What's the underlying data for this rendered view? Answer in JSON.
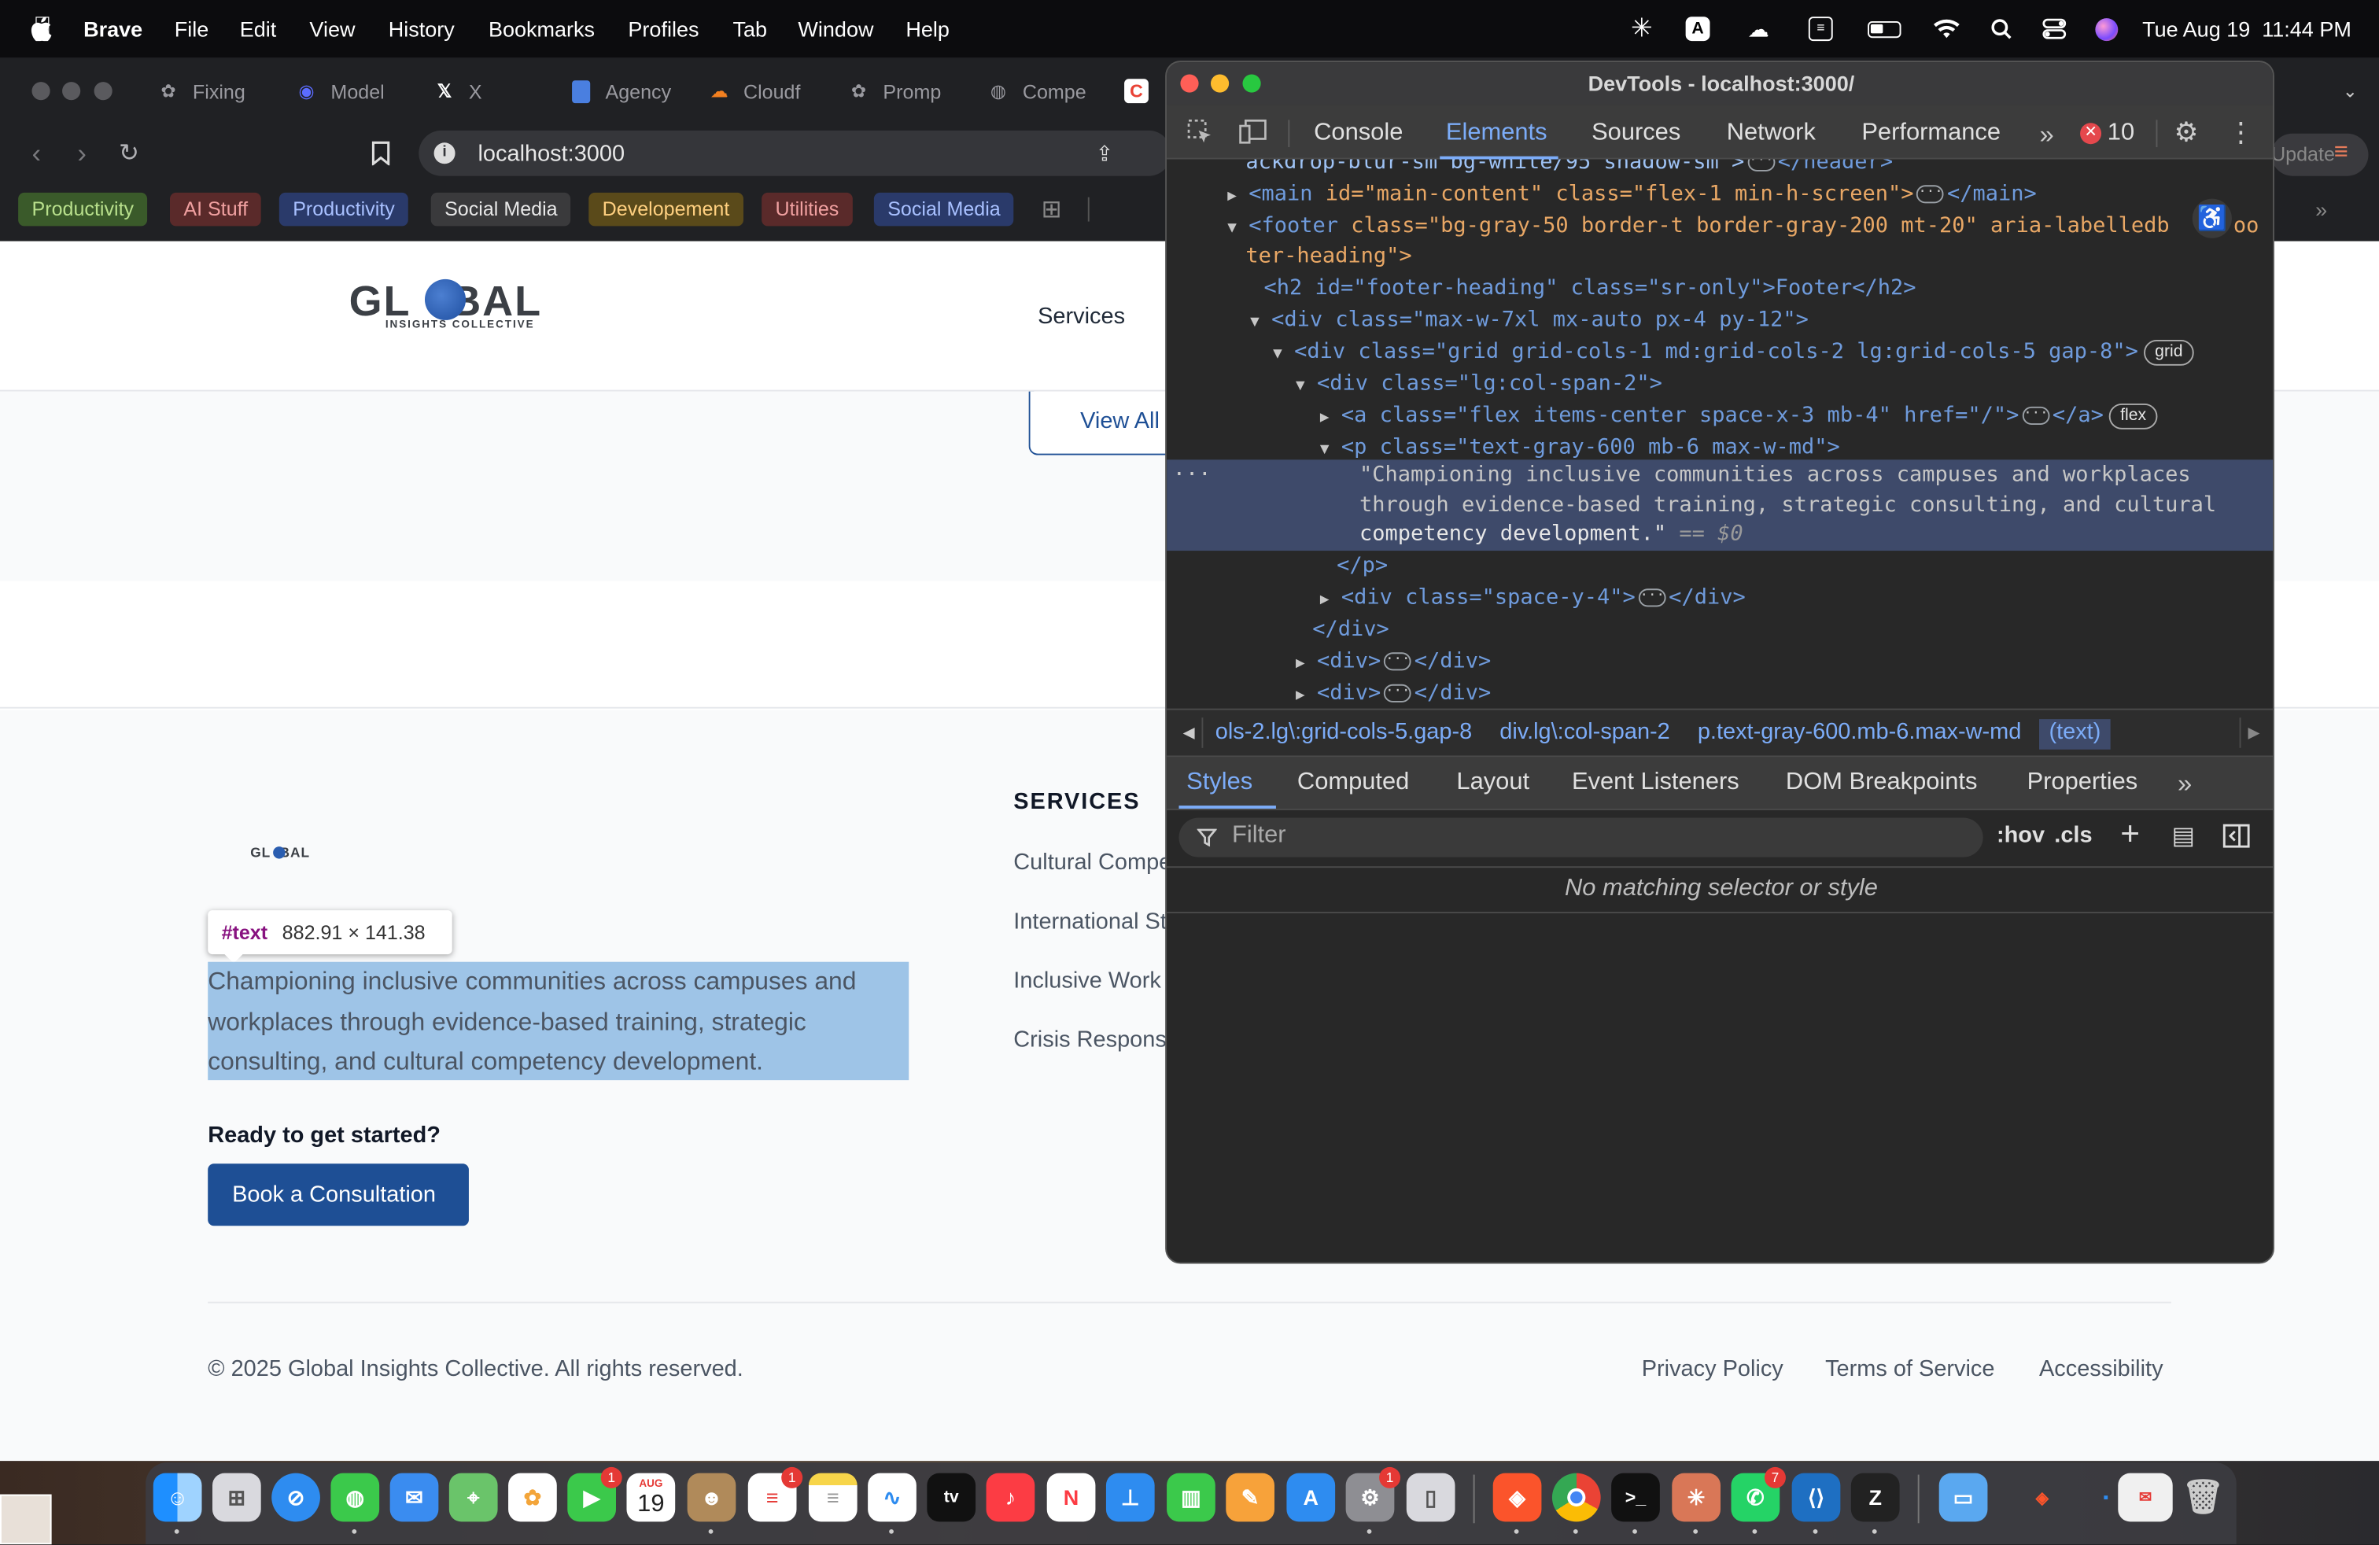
{
  "menubar": {
    "app": "Brave",
    "items": [
      "File",
      "Edit",
      "View",
      "History",
      "Bookmarks",
      "Profiles",
      "Tab",
      "Window",
      "Help"
    ],
    "datetime": "Tue Aug 19  11:44 PM"
  },
  "tabs": [
    "Fixing",
    "Model",
    "X",
    "Agency",
    "Cloudf",
    "Promp",
    "Compe"
  ],
  "address": {
    "url": "localhost:3000",
    "update_label": "Update"
  },
  "bookmarks": [
    {
      "label": "Productivity",
      "bg": "#3a5a2a",
      "fg": "#b8e08c"
    },
    {
      "label": "AI Stuff",
      "bg": "#5a2a2a",
      "fg": "#f0a0a0"
    },
    {
      "label": "Productivity",
      "bg": "#2a3a6a",
      "fg": "#a8c0ff"
    },
    {
      "label": "Social Media",
      "bg": "#3a3a3c",
      "fg": "#e8e8e8"
    },
    {
      "label": "Developement",
      "bg": "#5a4a1a",
      "fg": "#ffd080"
    },
    {
      "label": "Utilities",
      "bg": "#5a2a2a",
      "fg": "#f0a0a0"
    },
    {
      "label": "Social Media",
      "bg": "#2a3a6a",
      "fg": "#a8c0ff"
    }
  ],
  "site": {
    "logo_text": "GL   BAL",
    "logo_sub": "INSIGHTS COLLECTIVE",
    "nav_services": "Services",
    "view_all": "View All",
    "footer": {
      "logo_small": "GL  BAL",
      "tooltip_node": "#text",
      "tooltip_size": "882.91 × 141.38",
      "tagline": "Championing inclusive communities across campuses and workplaces through evidence-based training, strategic consulting, and cultural competency development.",
      "cta_heading": "Ready to get started?",
      "cta_button": "Book a Consultation",
      "services_heading": "SERVICES",
      "services": [
        "Cultural Compe",
        "International St",
        "Inclusive Work",
        "Crisis Respons"
      ],
      "copyright": "© 2025 Global Insights Collective. All rights reserved.",
      "links": [
        "Privacy Policy",
        "Terms of Service",
        "Accessibility"
      ]
    }
  },
  "devtools": {
    "title": "DevTools - localhost:3000/",
    "tabs": [
      "Console",
      "Elements",
      "Sources",
      "Network",
      "Performance"
    ],
    "error_count": "10",
    "tree": {
      "l0": "ackdrop-blur-sm bg-white/95 shadow-sm\">",
      "l0b": "</header>",
      "l1_tag": "<main",
      "l1_attrs": " id=\"main-content\" class=\"flex-1 min-h-screen\">",
      "l1_end": "</main>",
      "l2_tag": "<footer",
      "l2_attrs": " class=\"bg-gray-50 border-t border-gray-200 mt-20\" aria-labelledb",
      "l2_cont": "ter-heading\">",
      "l2_trail": "oo",
      "l3": "<h2 id=\"footer-heading\" class=\"sr-only\">Footer</h2>",
      "l4": "<div class=\"max-w-7xl mx-auto px-4 py-12\">",
      "l5": "<div class=\"grid grid-cols-1 md:grid-cols-2 lg:grid-cols-5 gap-8\">",
      "l5_badge": "grid",
      "l6": "<div class=\"lg:col-span-2\">",
      "l7": "<a class=\"flex items-center space-x-3 mb-4\" href=\"/\">",
      "l7_end": "</a>",
      "l7_badge": "flex",
      "l8": "<p class=\"text-gray-600 mb-6 max-w-md\">",
      "sel1": "\"Championing inclusive communities across campuses and workplaces",
      "sel2": "through evidence-based training, strategic consulting, and cultural",
      "sel3": "competency development.\"",
      "sel3_eq": " == $0",
      "l9": "</p>",
      "l10": "<div class=\"space-y-4\">",
      "l10_end": "</div>",
      "l11": "</div>",
      "l12": "<div>",
      "l12_end": "</div>",
      "l13": "<div>",
      "l13_end": "</div>"
    },
    "breadcrumbs": [
      "ols-2.lg\\:grid-cols-5.gap-8",
      "div.lg\\:col-span-2",
      "p.text-gray-600.mb-6.max-w-md",
      "(text)"
    ],
    "subtabs": [
      "Styles",
      "Computed",
      "Layout",
      "Event Listeners",
      "DOM Breakpoints",
      "Properties"
    ],
    "filter_placeholder": "Filter",
    "hov": ":hov",
    "cls": ".cls",
    "empty_msg": "No matching selector or style"
  },
  "dock": {
    "calendar_month": "AUG",
    "calendar_day": "19",
    "badges": [
      "1",
      "1",
      "1",
      "7"
    ]
  }
}
